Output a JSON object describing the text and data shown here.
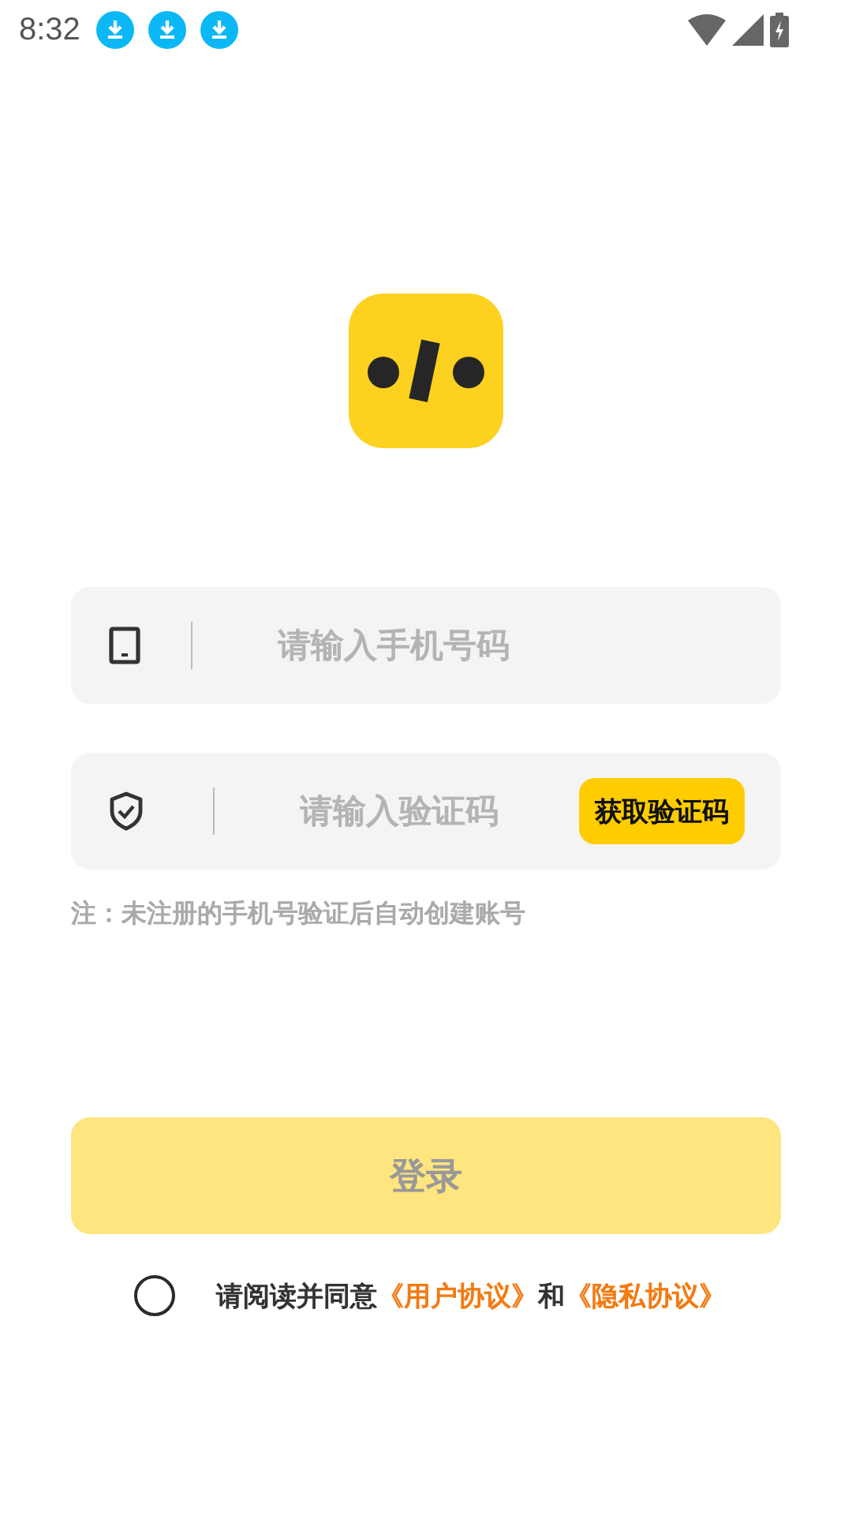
{
  "status_bar": {
    "time": "8:32",
    "notifications": [
      {
        "kind": "download"
      },
      {
        "kind": "download"
      },
      {
        "kind": "download"
      }
    ]
  },
  "phone_field": {
    "placeholder": "请输入手机号码"
  },
  "code_field": {
    "placeholder": "请输入验证码",
    "button": "获取验证码"
  },
  "note": "注：未注册的手机号验证后自动创建账号",
  "login_button": {
    "label": "登录",
    "disabled": true
  },
  "agreement": {
    "checked": false,
    "parts": [
      {
        "kind": "text",
        "text": "请阅读并同意"
      },
      {
        "kind": "link",
        "text": "《用户协议》"
      },
      {
        "kind": "text",
        "text": "和"
      },
      {
        "kind": "link",
        "text": "《隐私协议》"
      }
    ]
  }
}
